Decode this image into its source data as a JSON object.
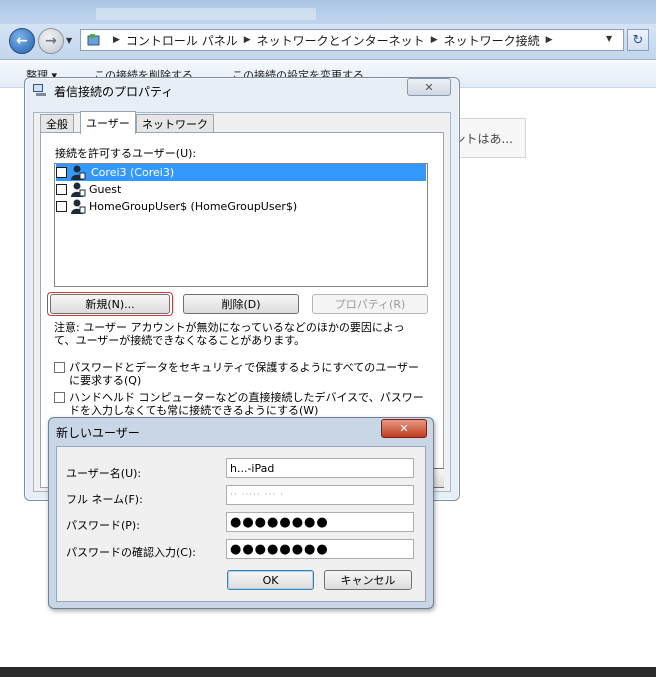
{
  "explorer": {
    "address_path": [
      "コントロール パネル",
      "ネットワークとインターネット",
      "ネットワーク接続"
    ],
    "commands": [
      "整理 ▾",
      "この接続を削除する",
      "この接続の設定を変更する"
    ],
    "content_card_text": "ントはあ..."
  },
  "properties": {
    "title": "着信接続のプロパティ",
    "tabs": [
      "全般",
      "ユーザー",
      "ネットワーク"
    ],
    "active_tab": "ユーザー",
    "allowed_users_label": "接続を許可するユーザー(U):",
    "users": [
      {
        "label": "Corei3 (Corei3)",
        "selected": true
      },
      {
        "label": "Guest",
        "selected": false
      },
      {
        "label": "HomeGroupUser$ (HomeGroupUser$)",
        "selected": false
      }
    ],
    "buttons": {
      "new": "新規(N)...",
      "delete": "削除(D)",
      "properties": "プロパティ(R)"
    },
    "note": "注意: ユーザー アカウントが無効になっているなどのほかの要因によって、ユーザーが接続できなくなることがあります。",
    "options": [
      "パスワードとデータをセキュリティで保護するようにすべてのユーザーに要求する(Q)",
      "ハンドヘルド コンピューターなどの直接接続したデバイスで、パスワードを入力しなくても常に接続できるようにする(W)"
    ]
  },
  "new_user": {
    "title": "新しいユーザー",
    "fields": [
      {
        "label": "ユーザー名(U):",
        "value": "h...-iPad"
      },
      {
        "label": "フル ネーム(F):",
        "value": "·· ·····  ···  ·"
      },
      {
        "label": "パスワード(P):",
        "value": "●●●●●●●●"
      },
      {
        "label": "パスワードの確認入力(C):",
        "value": "●●●●●●●●"
      }
    ],
    "ok_label": "OK",
    "cancel_label": "キャンセル"
  },
  "colors": {
    "selection": "#3399ff",
    "close_red": "#c03a1f",
    "highlight_ring": "#d23a3a"
  }
}
